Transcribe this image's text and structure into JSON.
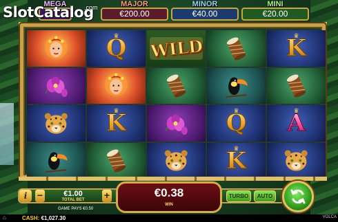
{
  "watermark": {
    "logo": "SlotCatalog",
    "suffix": ".com"
  },
  "jackpots": [
    {
      "name": "MEGA",
      "value": ""
    },
    {
      "name": "MAJOR",
      "value": "€200.00"
    },
    {
      "name": "MINOR",
      "value": "€40.00"
    },
    {
      "name": "MINI",
      "value": "€20.00"
    }
  ],
  "reels": [
    [
      "woman",
      "Q",
      "WILD",
      "drum",
      "K"
    ],
    [
      "orchid",
      "woman",
      "drum",
      "toucan",
      "drum"
    ],
    [
      "jaguar",
      "K",
      "orchid",
      "Q",
      "A"
    ],
    [
      "toucan",
      "drum",
      "jaguar",
      "K",
      "jaguar"
    ]
  ],
  "wild_label": "WILD",
  "controls": {
    "info_label": "i",
    "minus_label": "−",
    "plus_label": "+",
    "bet_value": "€1.00",
    "bet_label": "TOTAL BET",
    "game_pays": "GAME PAYS €0.50",
    "win_value": "€0.38",
    "win_label": "WIN",
    "turbo_label": "TURBO",
    "auto_label": "AUTO"
  },
  "status": {
    "cash_label": "CASH:",
    "cash_value": "€1,027.30",
    "brand": "VOLCA"
  },
  "colors": {
    "frame": "#c8a24a",
    "spin": "#3fb12a",
    "win_box": "#6d0f14"
  }
}
